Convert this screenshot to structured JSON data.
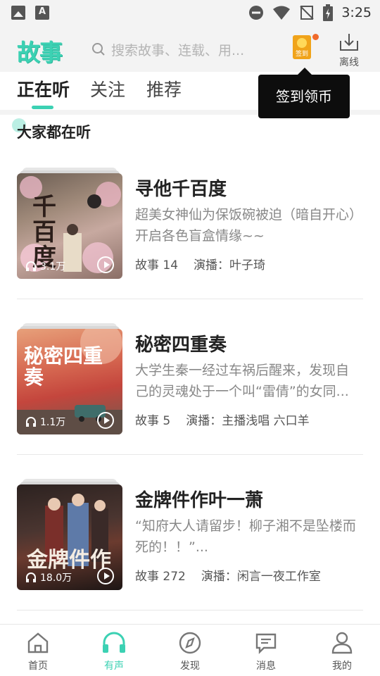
{
  "status_bar": {
    "time": "3:25"
  },
  "header": {
    "logo": "故事",
    "search_placeholder": "搜索故事、连载、用...",
    "signin_badge": "签到",
    "offline_label": "离线"
  },
  "tabs": [
    {
      "label": "正在听",
      "active": true
    },
    {
      "label": "关注",
      "active": false
    },
    {
      "label": "推荐",
      "active": false
    }
  ],
  "tooltip": "签到领币",
  "section_title": "大家都在听",
  "stories": [
    {
      "title": "寻他千百度",
      "desc": "超美女神仙为保饭碗被迫（暗自开心）开启各色盲盒情缘~~",
      "story_label": "故事",
      "story_count": "14",
      "narrator_label": "演播：",
      "narrator": "叶子琦",
      "plays": "3.1万",
      "cover_art": "千百度"
    },
    {
      "title": "秘密四重奏",
      "desc": "大学生秦一经过车祸后醒来，发现自己的灵魂处于一个叫“雷倩”的女同...",
      "story_label": "故事",
      "story_count": "5",
      "narrator_label": "演播：",
      "narrator": "主播浅唱 六口羊",
      "plays": "1.1万",
      "cover_art": "秘密四重奏"
    },
    {
      "title": "金牌件作叶一萧",
      "desc": "“知府大人请留步！柳子湘不是坠楼而死的！！”...",
      "story_label": "故事",
      "story_count": "272",
      "narrator_label": "演播：",
      "narrator": "闲言一夜工作室",
      "plays": "18.0万",
      "cover_art": "金牌件作"
    }
  ],
  "bottom_nav": [
    {
      "label": "首页",
      "active": false
    },
    {
      "label": "有声",
      "active": true
    },
    {
      "label": "发现",
      "active": false
    },
    {
      "label": "消息",
      "active": false
    },
    {
      "label": "我的",
      "active": false
    }
  ],
  "colors": {
    "accent": "#3cd1b3",
    "tooltip_bg": "#0d0d0d",
    "badge_dot": "#f06a2c"
  }
}
